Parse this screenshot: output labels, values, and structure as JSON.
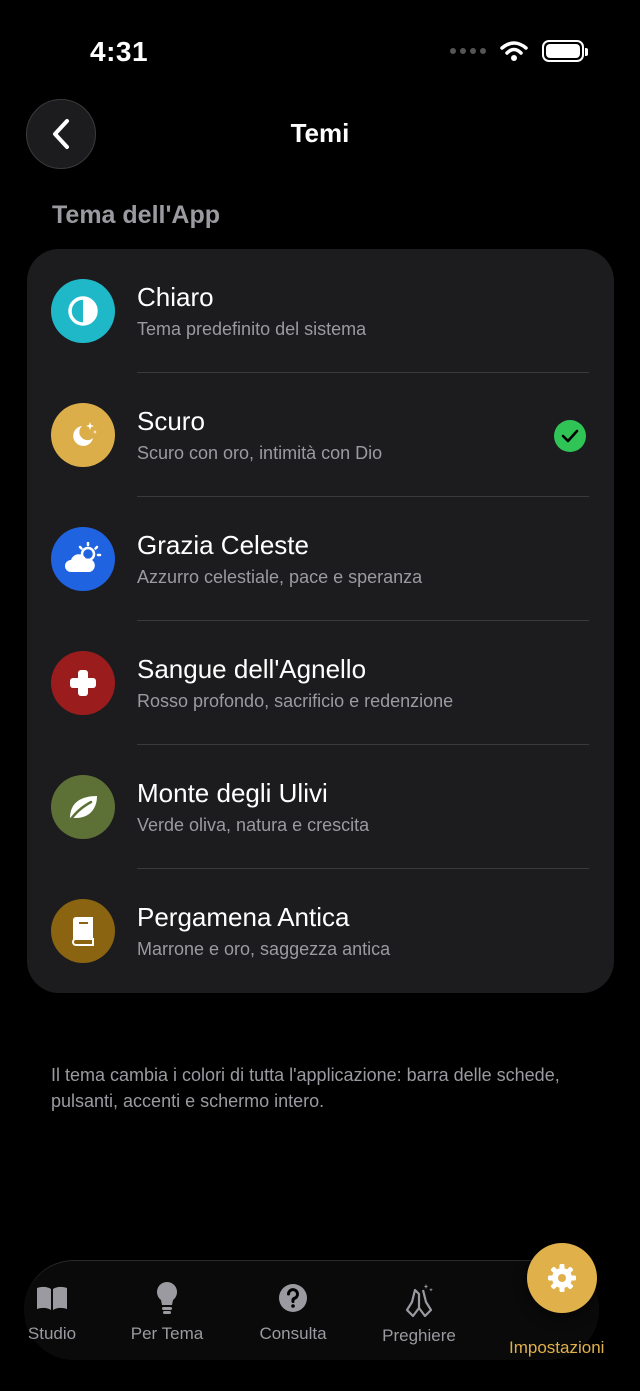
{
  "status": {
    "time": "4:31"
  },
  "header": {
    "title": "Temi"
  },
  "section": {
    "title": "Tema dell'App"
  },
  "themes": [
    {
      "title": "Chiaro",
      "subtitle": "Tema predefinito del sistema",
      "color": "#1fb8c8",
      "icon": "contrast-icon",
      "selected": false
    },
    {
      "title": "Scuro",
      "subtitle": "Scuro con oro, intimità con Dio",
      "color": "#dcae4a",
      "icon": "moon-stars-icon",
      "selected": true
    },
    {
      "title": "Grazia Celeste",
      "subtitle": "Azzurro celestiale, pace e speranza",
      "color": "#1f63e0",
      "icon": "cloud-sun-icon",
      "selected": false
    },
    {
      "title": "Sangue dell'Agnello",
      "subtitle": "Rosso profondo, sacrificio e redenzione",
      "color": "#9b1c1c",
      "icon": "cross-icon",
      "selected": false
    },
    {
      "title": "Monte degli Ulivi",
      "subtitle": "Verde oliva, natura e crescita",
      "color": "#5d7036",
      "icon": "leaf-icon",
      "selected": false
    },
    {
      "title": "Pergamena Antica",
      "subtitle": "Marrone e oro, saggezza antica",
      "color": "#8a6410",
      "icon": "book-icon",
      "selected": false
    }
  ],
  "footnote": "Il tema cambia i colori di tutta l'applicazione: barra delle schede, pulsanti, accenti e schermo intero.",
  "tabs": [
    {
      "label": "Studio",
      "icon": "book-open-icon"
    },
    {
      "label": "Per Tema",
      "icon": "lightbulb-icon"
    },
    {
      "label": "Consulta",
      "icon": "question-icon"
    },
    {
      "label": "Preghiere",
      "icon": "praying-hands-icon"
    },
    {
      "label": "Impostazioni",
      "icon": "gear-icon",
      "active": true
    }
  ],
  "colors": {
    "accent": "#e0b04a",
    "success": "#30c456",
    "card": "#1c1c1e"
  }
}
